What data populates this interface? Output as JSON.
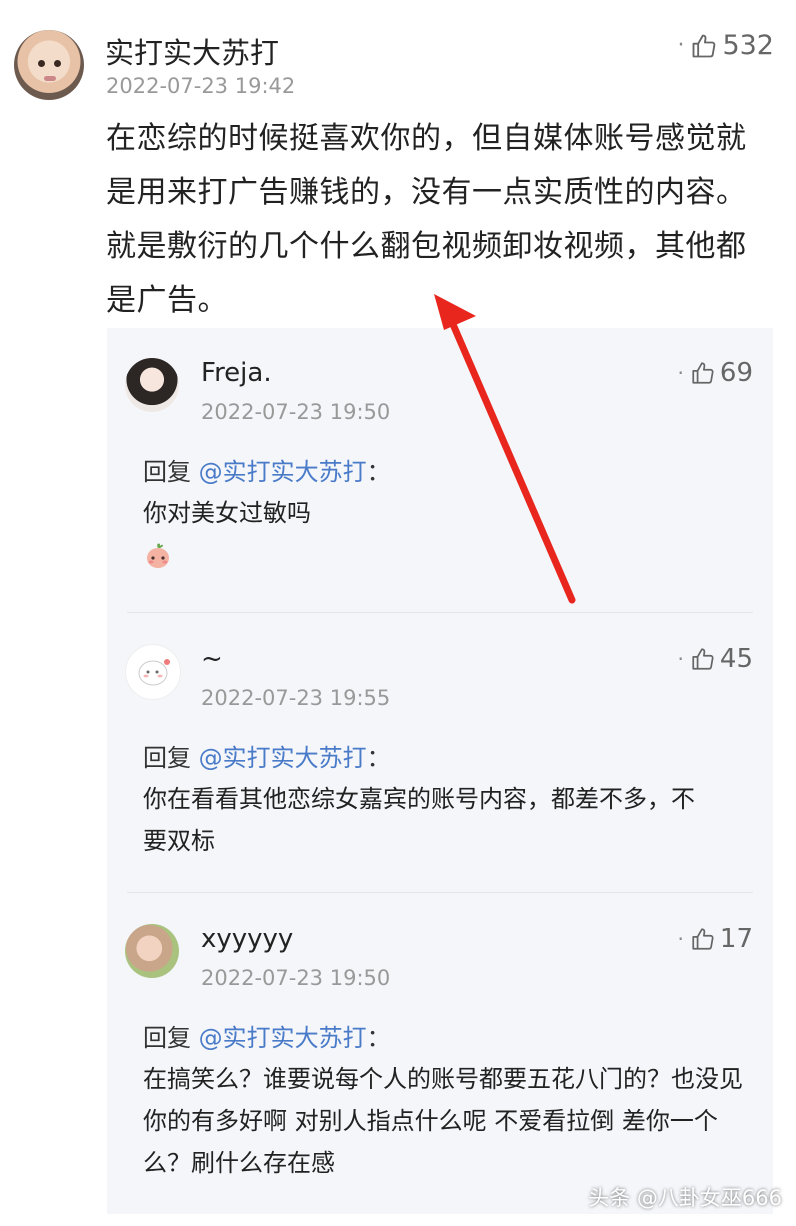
{
  "main_comment": {
    "username": "实打实大苏打",
    "timestamp": "2022-07-23 19:42",
    "likes": "532",
    "text": "在恋综的时候挺喜欢你的，但自媒体账号感觉就是用来打广告赚钱的，没有一点实质性的内容。就是敷衍的几个什么翻包视频卸妆视频，其他都是广告。"
  },
  "replies": [
    {
      "username": "Freja.",
      "timestamp": "2022-07-23 19:50",
      "likes": "69",
      "reply_prefix": "回复",
      "reply_to": "@实打实大苏打",
      "colon": "：",
      "body": "你对美女过敏吗"
    },
    {
      "username": "~",
      "timestamp": "2022-07-23 19:55",
      "likes": "45",
      "reply_prefix": "回复",
      "reply_to": "@实打实大苏打",
      "colon": "：",
      "body": "你在看看其他恋综女嘉宾的账号内容，都差不多，不要双标"
    },
    {
      "username": "xyyyyy",
      "timestamp": "2022-07-23 19:50",
      "likes": "17",
      "reply_prefix": "回复",
      "reply_to": "@实打实大苏打",
      "colon": "：",
      "body": "在搞笑么？谁要说每个人的账号都要五花八门的？也没见你的有多好啊 对别人指点什么呢 不爱看拉倒 差你一个么？刷什么存在感"
    }
  ],
  "ui": {
    "dot": "·"
  },
  "watermark": "头条 @八卦女巫666",
  "colors": {
    "link": "#4a7bc8",
    "arrow": "#e8261e",
    "panel_bg": "#f4f6fa"
  },
  "icons": [
    "thumbs-up-icon",
    "blush-emoji-icon",
    "arrow-annotation"
  ]
}
